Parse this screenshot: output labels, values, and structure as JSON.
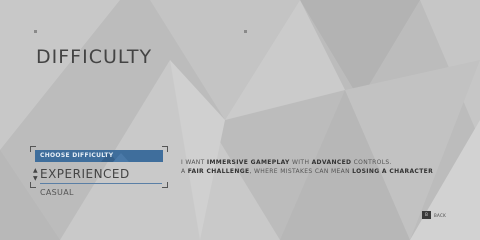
{
  "screen": {
    "title": "DIFFICULTY"
  },
  "difficulty_selector": {
    "header_label": "CHOOSE DIFFICULTY",
    "selected_value": "EXPERIENCED",
    "next_option": "CASUAL",
    "arrow_up": "▲",
    "arrow_down": "▼"
  },
  "description": {
    "line1_a": "I WANT ",
    "line1_b": "IMMERSIVE GAMEPLAY",
    "line1_c": " WITH ",
    "line1_d": "ADVANCED",
    "line1_e": " CONTROLS.",
    "line2_a": "A ",
    "line2_b": "FAIR CHALLENGE",
    "line2_c": ", WHERE MISTAKES CAN MEAN ",
    "line2_d": "LOSING A CHARACTER"
  },
  "footer": {
    "back_key": "B",
    "back_label": "BACK"
  },
  "colors": {
    "background": "#bdbdbd",
    "accent": "#3f6e9c",
    "text": "#4a4a4a"
  }
}
